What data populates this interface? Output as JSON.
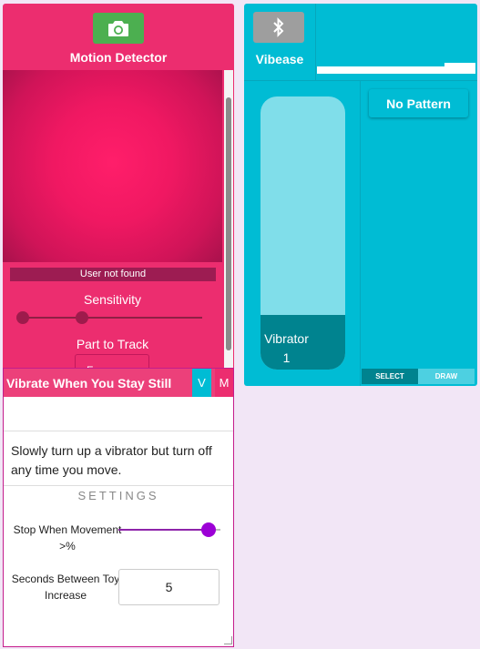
{
  "colors": {
    "motion_bg": "#ec2d6f",
    "vibease_bg": "#00bcd4",
    "camera_button": "#4caf50",
    "bluetooth_button": "#9e9e9e",
    "slider_accent": "#9c00d6",
    "page_bg": "#f2e6f6"
  },
  "motion_detector": {
    "title": "Motion Detector",
    "camera_icon": "camera-icon",
    "user_status": "User not found",
    "sensitivity_label": "Sensitivity",
    "sensitivity_low": 0.0,
    "sensitivity_high": 0.33,
    "part_to_track_label": "Part to Track",
    "part_to_track_value": "Face"
  },
  "vibease": {
    "title": "Vibease",
    "bluetooth_icon": "bluetooth-icon",
    "vibrator_name": "Vibrator",
    "vibrator_number": "1",
    "vibrator_level": 0.2,
    "pattern_button": "No Pattern",
    "mode_select": "SELECT",
    "mode_draw": "DRAW"
  },
  "still_panel": {
    "title": "Vibrate When You Stay Still",
    "v_button": "V",
    "m_button": "M",
    "description": "Slowly turn up a vibrator but turn off any time you move.",
    "settings_title": "SETTINGS",
    "stop_movement_label": "Stop When Movement >%",
    "stop_movement_value": 0.88,
    "seconds_label": "Seconds Between Toy Increase",
    "seconds_value": "5"
  }
}
